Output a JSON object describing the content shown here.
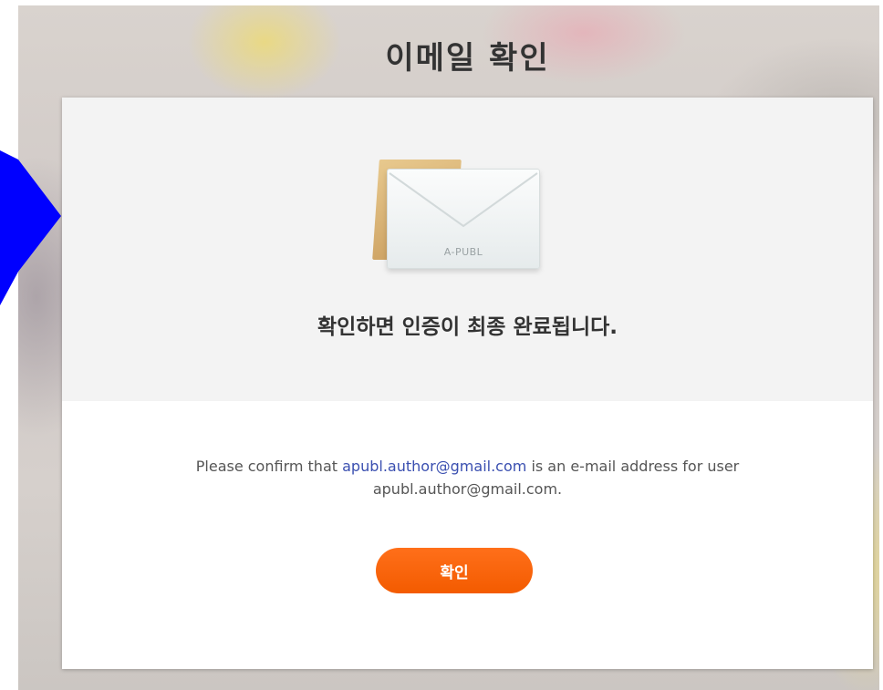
{
  "header": {
    "title": "이메일 확인"
  },
  "envelope": {
    "brand": "A-PUBL"
  },
  "card": {
    "headline": "확인하면 인증이 최종 완료됩니다.",
    "message_prefix": "Please confirm that",
    "email_link": "apubl.author@gmail.com",
    "message_suffix": "is an e-mail address for user",
    "user_email": "apubl.author@gmail.com.",
    "confirm_button": "확인"
  },
  "colors": {
    "accent": "#f35b00",
    "link": "#3a4fb0",
    "pointer": "#0000ff"
  }
}
